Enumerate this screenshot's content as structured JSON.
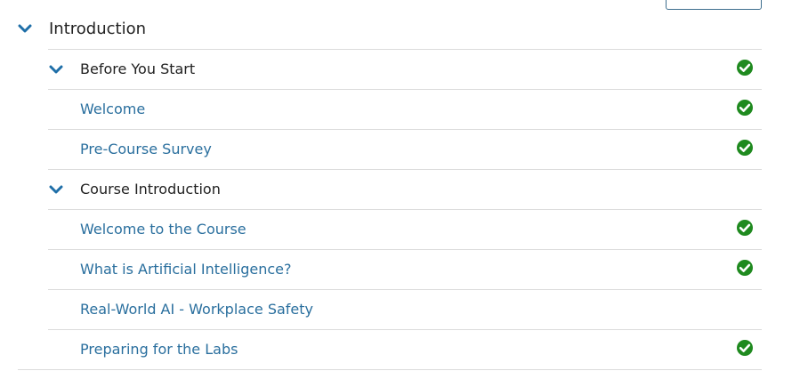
{
  "colors": {
    "accent": "#1f6fa8",
    "link": "#2a6f9e",
    "heading_text": "#222222",
    "complete": "#1f8a1f",
    "divider": "#dcdcdc"
  },
  "section": {
    "title": "Introduction",
    "icon": "chevron-down-icon"
  },
  "subsections": [
    {
      "title": "Before You Start",
      "completed": true,
      "lessons": [
        {
          "label": "Welcome",
          "completed": true
        },
        {
          "label": "Pre-Course Survey",
          "completed": true
        }
      ]
    },
    {
      "title": "Course Introduction",
      "completed": false,
      "lessons": [
        {
          "label": "Welcome to the Course",
          "completed": true
        },
        {
          "label": "What is Artificial Intelligence?",
          "completed": true
        },
        {
          "label": "Real-World AI - Workplace Safety",
          "completed": false
        },
        {
          "label": "Preparing for the Labs",
          "completed": true
        }
      ]
    }
  ]
}
